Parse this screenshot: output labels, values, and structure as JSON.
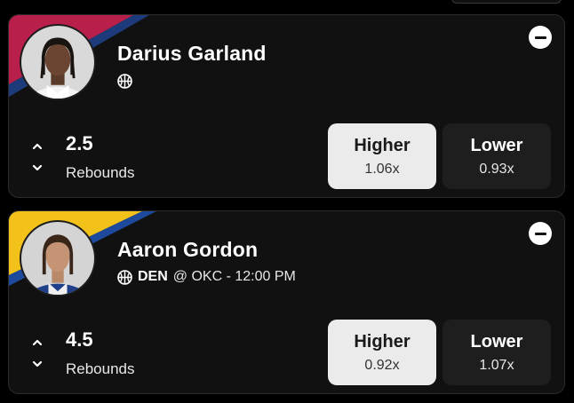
{
  "colors": {
    "card_bg": "#111111",
    "higher_selected_bg": "#ebebeb",
    "lower_bg": "#1e1e1e",
    "card1_stripe": [
      "#b81f4b",
      "#1d3a7a"
    ],
    "card2_stripe": [
      "#f2c21b",
      "#1d4a9c"
    ]
  },
  "cards": [
    {
      "player_name": "Darius Garland",
      "sport_icon": "basketball-icon",
      "game": {
        "team": "",
        "rest": ""
      },
      "line": "2.5",
      "stat": "Rebounds",
      "higher": {
        "label": "Higher",
        "multiplier": "1.06x",
        "selected": true
      },
      "lower": {
        "label": "Lower",
        "multiplier": "0.93x",
        "selected": false
      }
    },
    {
      "player_name": "Aaron Gordon",
      "sport_icon": "basketball-icon",
      "game": {
        "team": "DEN",
        "rest": "@ OKC - 12:00 PM"
      },
      "line": "4.5",
      "stat": "Rebounds",
      "higher": {
        "label": "Higher",
        "multiplier": "0.92x",
        "selected": true
      },
      "lower": {
        "label": "Lower",
        "multiplier": "1.07x",
        "selected": false
      }
    }
  ]
}
